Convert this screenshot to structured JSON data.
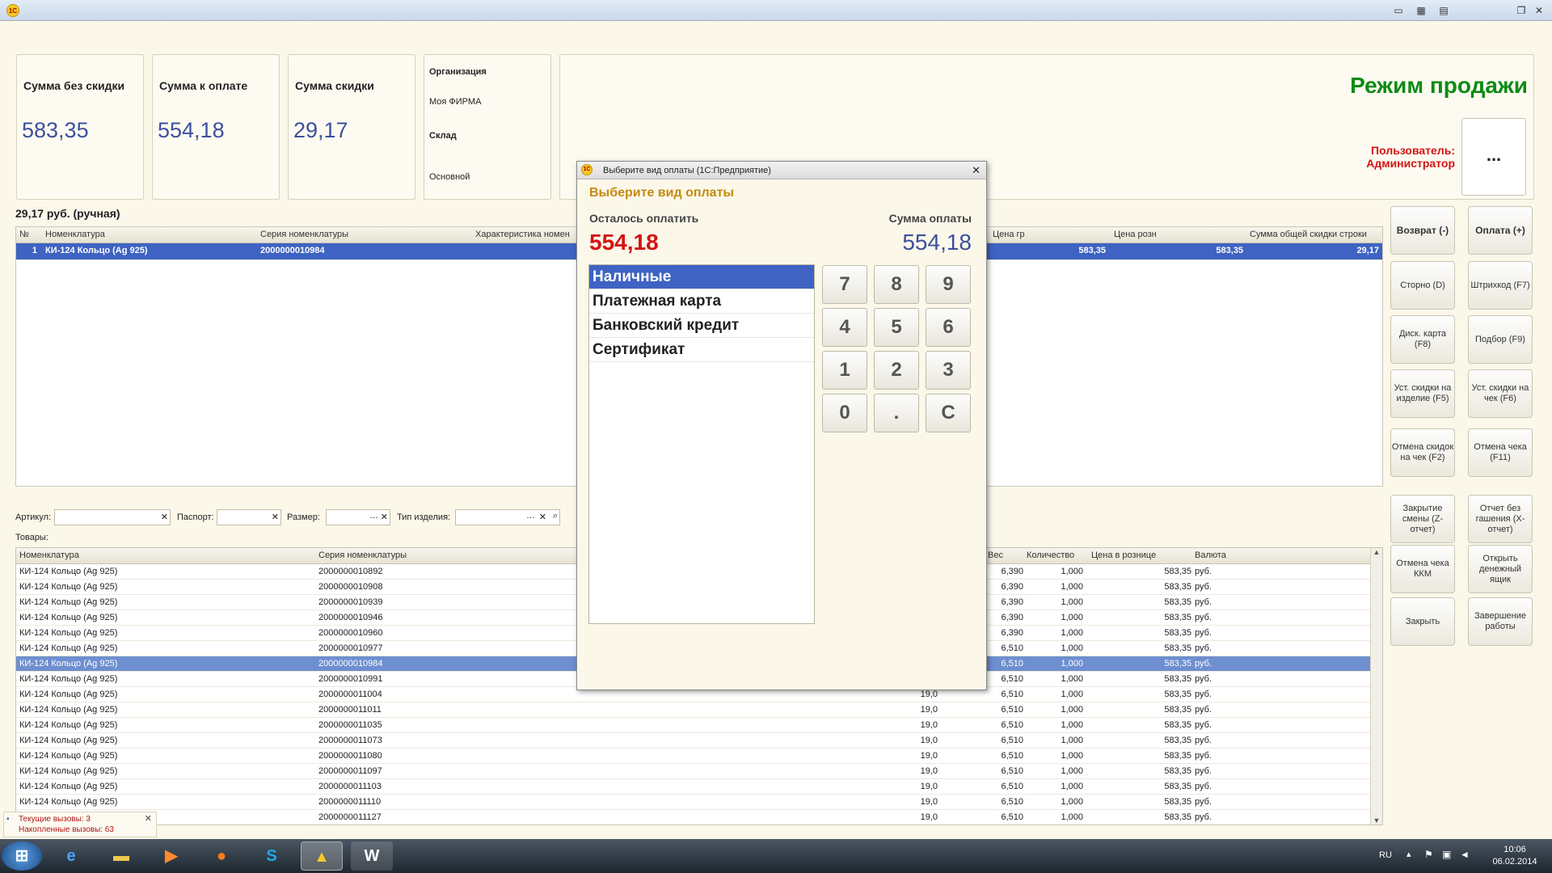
{
  "window": {
    "logo": "1C"
  },
  "cards": [
    {
      "title": "Сумма без скидки",
      "value": "583,35"
    },
    {
      "title": "Сумма к оплате",
      "value": "554,18"
    },
    {
      "title": "Сумма скидки",
      "value": "29,17"
    }
  ],
  "org": {
    "org_label": "Организация",
    "org_value": "Моя ФИРМА",
    "wh_label": "Склад",
    "wh_value": "Основной"
  },
  "mode": "Режим продажи",
  "user": {
    "label": "Пользователь:",
    "name": "Администратор",
    "more_button": "..."
  },
  "discount_note": "29,17 руб. (ручная)",
  "check_table": {
    "headers": [
      "№",
      "Номенклатура",
      "Серия номенклатуры",
      "Характеристика номен",
      "Цена гр",
      "Цена розн",
      "Сумма общей скидки строки"
    ],
    "row": {
      "n": "1",
      "name": "КИ-124 Кольцо  (Ag 925)",
      "serial": "2000000010984",
      "price_gr": "583,35",
      "price_rozn": "583,35",
      "discount": "29,17"
    }
  },
  "side_buttons": [
    {
      "label": "Возврат (-)",
      "bold": true
    },
    {
      "label": "Оплата (+)",
      "bold": true
    },
    {
      "label": "Сторно (D)"
    },
    {
      "label": "Штрихкод (F7)"
    },
    {
      "label": "Диск. карта (F8)"
    },
    {
      "label": "Подбор (F9)"
    },
    {
      "label": "Уст. скидки на изделие (F5)"
    },
    {
      "label": "Уст. скидки на чек (F6)"
    },
    {
      "label": "Отмена скидок на чек (F2)"
    },
    {
      "label": "Отмена чека (F11)"
    },
    {
      "label": "Закрытие смены (Z-отчет)"
    },
    {
      "label": "Отчет без гашения (X-отчет)"
    },
    {
      "label": "Отмена чека ККМ"
    },
    {
      "label": "Открыть денежный ящик"
    },
    {
      "label": "Закрыть"
    },
    {
      "label": "Завершение работы"
    }
  ],
  "filters": {
    "article": "Артикул:",
    "passport": "Паспорт:",
    "size": "Размер:",
    "type": "Тип изделия:"
  },
  "goods_label": "Товары:",
  "goods_table": {
    "headers": [
      "Номенклатура",
      "Серия номенклатуры",
      "Вес",
      "Количество",
      "Цена в рознице",
      "Валюта"
    ],
    "rows": [
      {
        "name": "КИ-124 Кольцо  (Ag 925)",
        "serial": "2000000010892",
        "size": "",
        "weight": "6,390",
        "qty": "1,000",
        "price": "583,35",
        "cur": "руб."
      },
      {
        "name": "КИ-124 Кольцо  (Ag 925)",
        "serial": "2000000010908",
        "size": "",
        "weight": "6,390",
        "qty": "1,000",
        "price": "583,35",
        "cur": "руб."
      },
      {
        "name": "КИ-124 Кольцо  (Ag 925)",
        "serial": "2000000010939",
        "size": "",
        "weight": "6,390",
        "qty": "1,000",
        "price": "583,35",
        "cur": "руб."
      },
      {
        "name": "КИ-124 Кольцо  (Ag 925)",
        "serial": "2000000010946",
        "size": "",
        "weight": "6,390",
        "qty": "1,000",
        "price": "583,35",
        "cur": "руб."
      },
      {
        "name": "КИ-124 Кольцо  (Ag 925)",
        "serial": "2000000010960",
        "size": "",
        "weight": "6,390",
        "qty": "1,000",
        "price": "583,35",
        "cur": "руб."
      },
      {
        "name": "КИ-124 Кольцо  (Ag 925)",
        "serial": "2000000010977",
        "size": "",
        "weight": "6,510",
        "qty": "1,000",
        "price": "583,35",
        "cur": "руб."
      },
      {
        "name": "КИ-124 Кольцо  (Ag 925)",
        "serial": "2000000010984",
        "size": "",
        "weight": "6,510",
        "qty": "1,000",
        "price": "583,35",
        "cur": "руб."
      },
      {
        "name": "КИ-124 Кольцо  (Ag 925)",
        "serial": "2000000010991",
        "size": "",
        "weight": "6,510",
        "qty": "1,000",
        "price": "583,35",
        "cur": "руб."
      },
      {
        "name": "КИ-124 Кольцо  (Ag 925)",
        "serial": "2000000011004",
        "size": "19,0",
        "weight": "6,510",
        "qty": "1,000",
        "price": "583,35",
        "cur": "руб."
      },
      {
        "name": "КИ-124 Кольцо  (Ag 925)",
        "serial": "2000000011011",
        "size": "19,0",
        "weight": "6,510",
        "qty": "1,000",
        "price": "583,35",
        "cur": "руб."
      },
      {
        "name": "КИ-124 Кольцо  (Ag 925)",
        "serial": "2000000011035",
        "size": "19,0",
        "weight": "6,510",
        "qty": "1,000",
        "price": "583,35",
        "cur": "руб."
      },
      {
        "name": "КИ-124 Кольцо  (Ag 925)",
        "serial": "2000000011073",
        "size": "19,0",
        "weight": "6,510",
        "qty": "1,000",
        "price": "583,35",
        "cur": "руб."
      },
      {
        "name": "КИ-124 Кольцо  (Ag 925)",
        "serial": "2000000011080",
        "size": "19,0",
        "weight": "6,510",
        "qty": "1,000",
        "price": "583,35",
        "cur": "руб."
      },
      {
        "name": "КИ-124 Кольцо  (Ag 925)",
        "serial": "2000000011097",
        "size": "19,0",
        "weight": "6,510",
        "qty": "1,000",
        "price": "583,35",
        "cur": "руб."
      },
      {
        "name": "КИ-124 Кольцо  (Ag 925)",
        "serial": "2000000011103",
        "size": "19,0",
        "weight": "6,510",
        "qty": "1,000",
        "price": "583,35",
        "cur": "руб."
      },
      {
        "name": "КИ-124 Кольцо  (Ag 925)",
        "serial": "2000000011110",
        "size": "19,0",
        "weight": "6,510",
        "qty": "1,000",
        "price": "583,35",
        "cur": "руб."
      },
      {
        "name": "",
        "serial": "2000000011127",
        "size": "19,0",
        "weight": "6,510",
        "qty": "1,000",
        "price": "583,35",
        "cur": "руб."
      }
    ]
  },
  "notice": {
    "line1": "Текущие вызовы: 3",
    "line2": "Накопленные вызовы: 63"
  },
  "dialog": {
    "window_title": "Выберите вид оплаты  (1С:Предприятие)",
    "heading": "Выберите вид оплаты",
    "remaining_label": "Осталось оплатить",
    "remaining_value": "554,18",
    "sum_label": "Сумма оплаты",
    "sum_value": "554,18",
    "payment_types": [
      "Наличные",
      "Платежная карта",
      "Банковский кредит",
      "Сертификат"
    ],
    "keys": [
      "7",
      "8",
      "9",
      "4",
      "5",
      "6",
      "1",
      "2",
      "3",
      "0",
      ".",
      "C"
    ]
  },
  "tray": {
    "lang": "RU",
    "time": "10:06",
    "date": "06.02.2014"
  },
  "colors": {
    "accent_green": "#0f8a14",
    "user_red": "#d41414",
    "value_blue": "#3d4f9e",
    "selection": "#3e63c2"
  }
}
